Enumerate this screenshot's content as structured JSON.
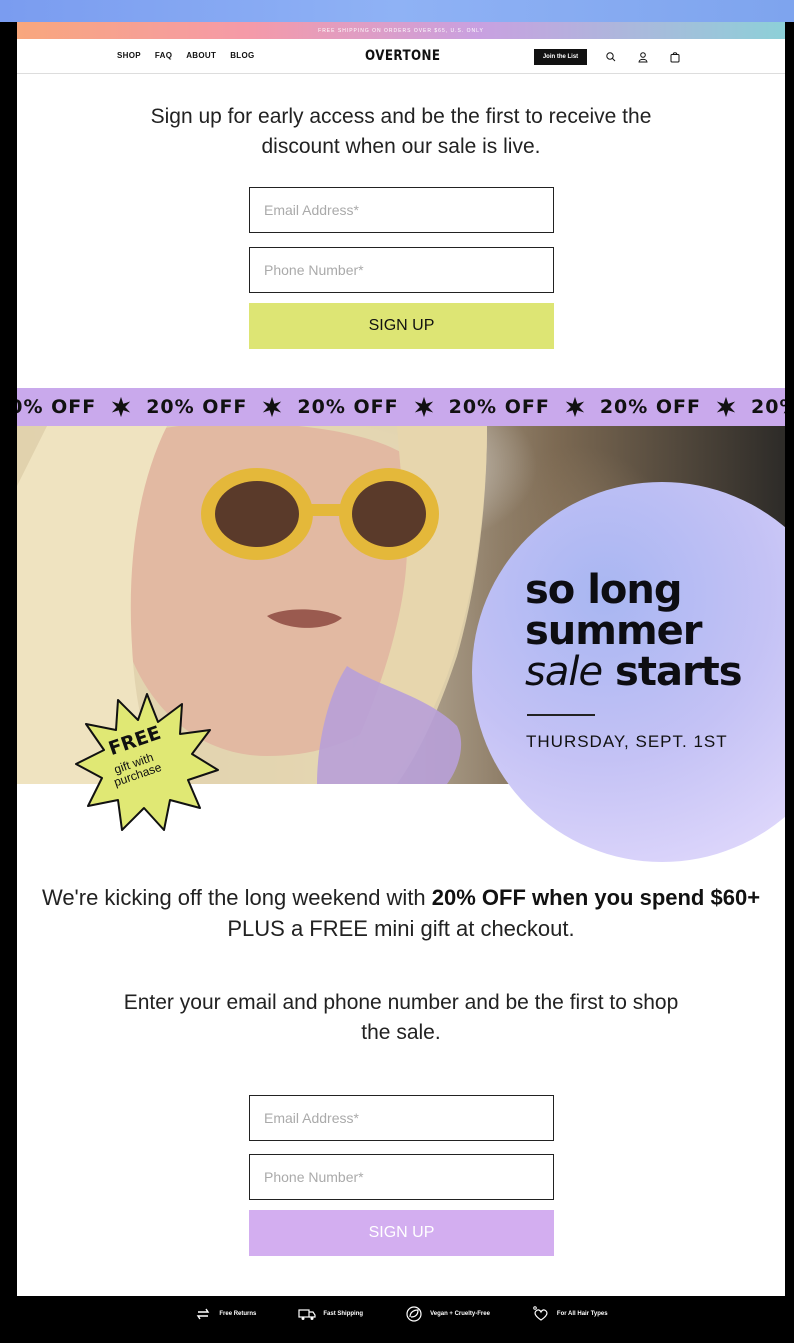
{
  "promo": {
    "text": "FREE SHIPPING ON ORDERS OVER $65, U.S. ONLY"
  },
  "header": {
    "nav": [
      "SHOP",
      "FAQ",
      "ABOUT",
      "BLOG"
    ],
    "logo": "OVERTONE",
    "join_label": "Join the List",
    "icons": [
      "search-icon",
      "account-icon",
      "bag-icon"
    ]
  },
  "top_signup": {
    "lead": "Sign up for early access and be the first to receive the discount when our sale is live.",
    "email_placeholder": "Email Address*",
    "phone_placeholder": "Phone Number*",
    "button": "SIGN UP",
    "button_color": "#dde574"
  },
  "ticker": {
    "item": "20% OFF",
    "color": "#c9a9ec"
  },
  "hero": {
    "line1": "so long",
    "line2": "summer",
    "line3_italic": "sale",
    "line3_bold": "starts",
    "date": "THURSDAY, SEPT. 1ST",
    "badge_free": "FREE",
    "badge_sub_1": "gift with",
    "badge_sub_2": "purchase",
    "badge_color": "#e0e874"
  },
  "offer": {
    "pre": "We're kicking off the long weekend with ",
    "bold": "20% OFF when you spend $60+",
    "post": " PLUS a FREE mini gift at checkout."
  },
  "bottom_signup": {
    "lead": "Enter your email and phone number and be the first to shop the sale.",
    "email_placeholder": "Email Address*",
    "phone_placeholder": "Phone Number*",
    "button": "SIGN UP",
    "button_color": "#d3aef0"
  },
  "footer": {
    "features": [
      "Free Returns",
      "Fast Shipping",
      "Vegan + Cruelty-Free",
      "For All Hair Types"
    ]
  }
}
